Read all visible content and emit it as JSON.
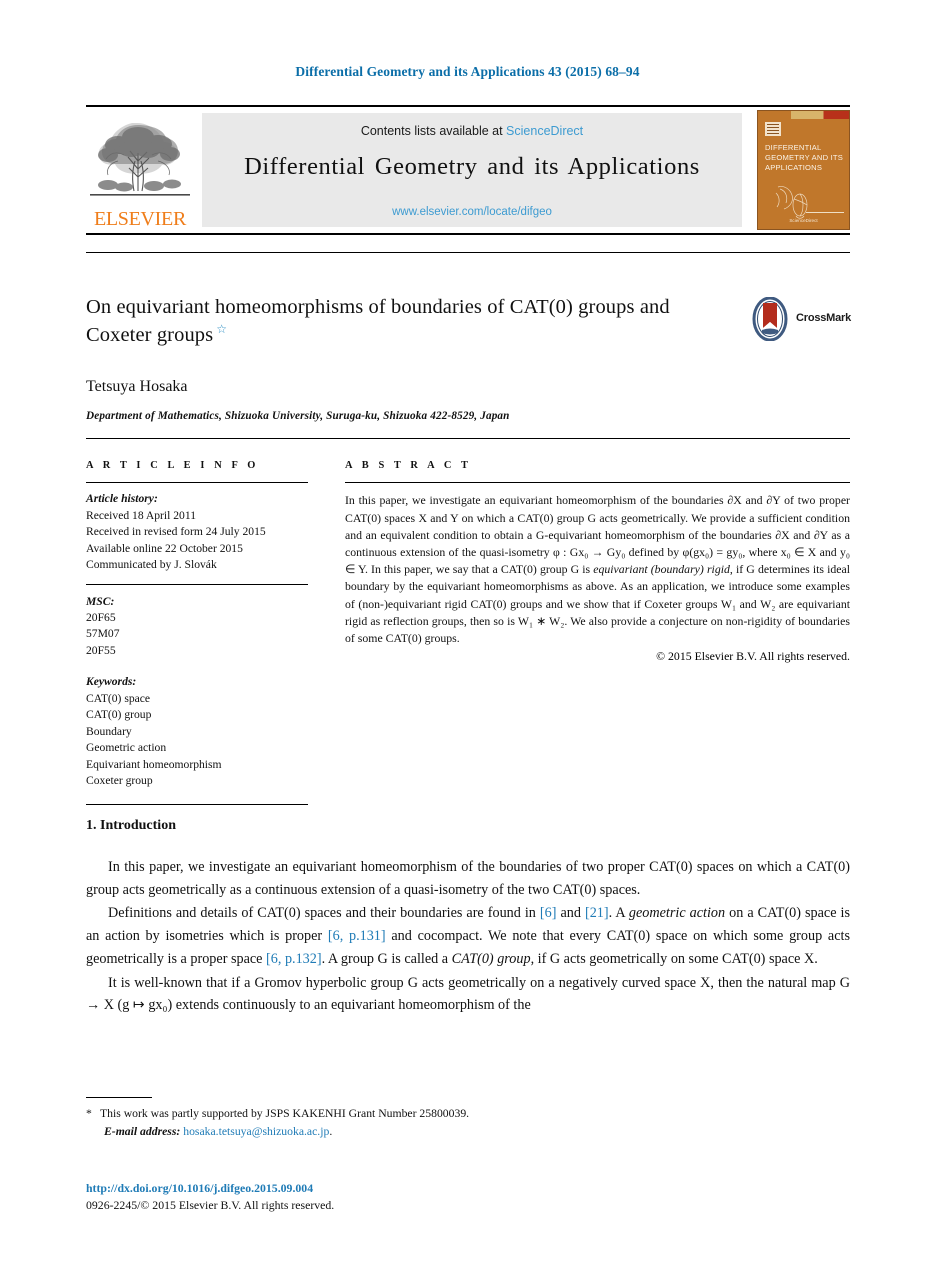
{
  "running_head": "Differential Geometry and its Applications 43 (2015) 68–94",
  "masthead": {
    "publisher_name": "ELSEVIER",
    "contents_prefix": "Contents lists available at ",
    "contents_link": "ScienceDirect",
    "journal_title": "Differential Geometry and its Applications",
    "journal_url": "www.elsevier.com/locate/difgeo",
    "cover": {
      "title_lines": [
        "DIFFERENTIAL",
        "GEOMETRY AND ITS",
        "APPLICATIONS"
      ],
      "footer": "ScienceDirect"
    }
  },
  "article": {
    "title": "On equivariant homeomorphisms of boundaries of CAT(0) groups and Coxeter groups",
    "title_marker": "☆",
    "crossmark_label": "CrossMark",
    "author": "Tetsuya Hosaka",
    "affiliation": "Department of Mathematics, Shizuoka University, Suruga-ku, Shizuoka 422-8529, Japan"
  },
  "info": {
    "heading": "A R T I C L E   I N F O",
    "history_label": "Article history:",
    "history_lines": [
      "Received 18 April 2011",
      "Received in revised form 24 July 2015",
      "Available online 22 October 2015",
      "Communicated by J. Slovák"
    ],
    "msc_label": "MSC:",
    "msc_codes": [
      "20F65",
      "57M07",
      "20F55"
    ],
    "keywords_label": "Keywords:",
    "keywords": [
      "CAT(0) space",
      "CAT(0) group",
      "Boundary",
      "Geometric action",
      "Equivariant homeomorphism",
      "Coxeter group"
    ]
  },
  "abstract": {
    "heading": "A B S T R A C T",
    "paragraph_html": "In this paper, we investigate an equivariant homeomorphism of the boundaries ∂X and ∂Y of two proper CAT(0) spaces X and Y on which a CAT(0) group G acts geometrically. We provide a sufficient condition and an equivalent condition to obtain a G-equivariant homeomorphism of the boundaries ∂X and ∂Y as a continuous extension of the quasi-isometry φ : Gx₀ → Gy₀ defined by φ(gx₀) = gy₀, where x₀ ∈ X and y₀ ∈ Y. In this paper, we say that a CAT(0) group G is <i>equivariant (boundary) rigid</i>, if G determines its ideal boundary by the equivariant homeomorphisms as above. As an application, we introduce some examples of (non-)equivariant rigid CAT(0) groups and we show that if Coxeter groups W₁ and W₂ are equivariant rigid as reflection groups, then so is W₁ ∗ W₂. We also provide a conjecture on non-rigidity of boundaries of some CAT(0) groups.",
    "copyright": "© 2015 Elsevier B.V. All rights reserved."
  },
  "body": {
    "section_heading": "1. Introduction",
    "paragraphs_html": [
      "In this paper, we investigate an equivariant homeomorphism of the boundaries of two proper CAT(0) spaces on which a CAT(0) group acts geometrically as a continuous extension of a quasi-isometry of the two CAT(0) spaces.",
      "Definitions and details of CAT(0) spaces and their boundaries are found in <span class=\"ref\">[6]</span> and <span class=\"ref\">[21]</span>. A <i>geometric action</i> on a CAT(0) space is an action by isometries which is proper <span class=\"ref\">[6, p.131]</span> and cocompact. We note that every CAT(0) space on which some group acts geometrically is a proper space <span class=\"ref\">[6, p.132]</span>. A group G is called a <i>CAT(0) group</i>, if G acts geometrically on some CAT(0) space X.",
      "It is well-known that if a Gromov hyperbolic group G acts geometrically on a negatively curved space X, then the natural map G → X (g ↦ gx₀) extends continuously to an equivariant homeomorphism of the"
    ]
  },
  "footnotes": {
    "star_marker": "*",
    "funding": "This work was partly supported by JSPS KAKENHI Grant Number 25800039.",
    "email_label": "E-mail address:",
    "email": "hosaka.tetsuya@shizuoka.ac.jp"
  },
  "imprint": {
    "doi": "http://dx.doi.org/10.1016/j.difgeo.2015.09.004",
    "issn_line": "0926-2245/© 2015 Elsevier B.V. All rights reserved."
  },
  "colors": {
    "link_blue": "#1f7bb6",
    "header_blue": "#0b6ea8",
    "sciencedirect_blue": "#3d9bd1",
    "elsevier_orange": "#ef7d1a",
    "cover_orange": "#c0772b"
  }
}
